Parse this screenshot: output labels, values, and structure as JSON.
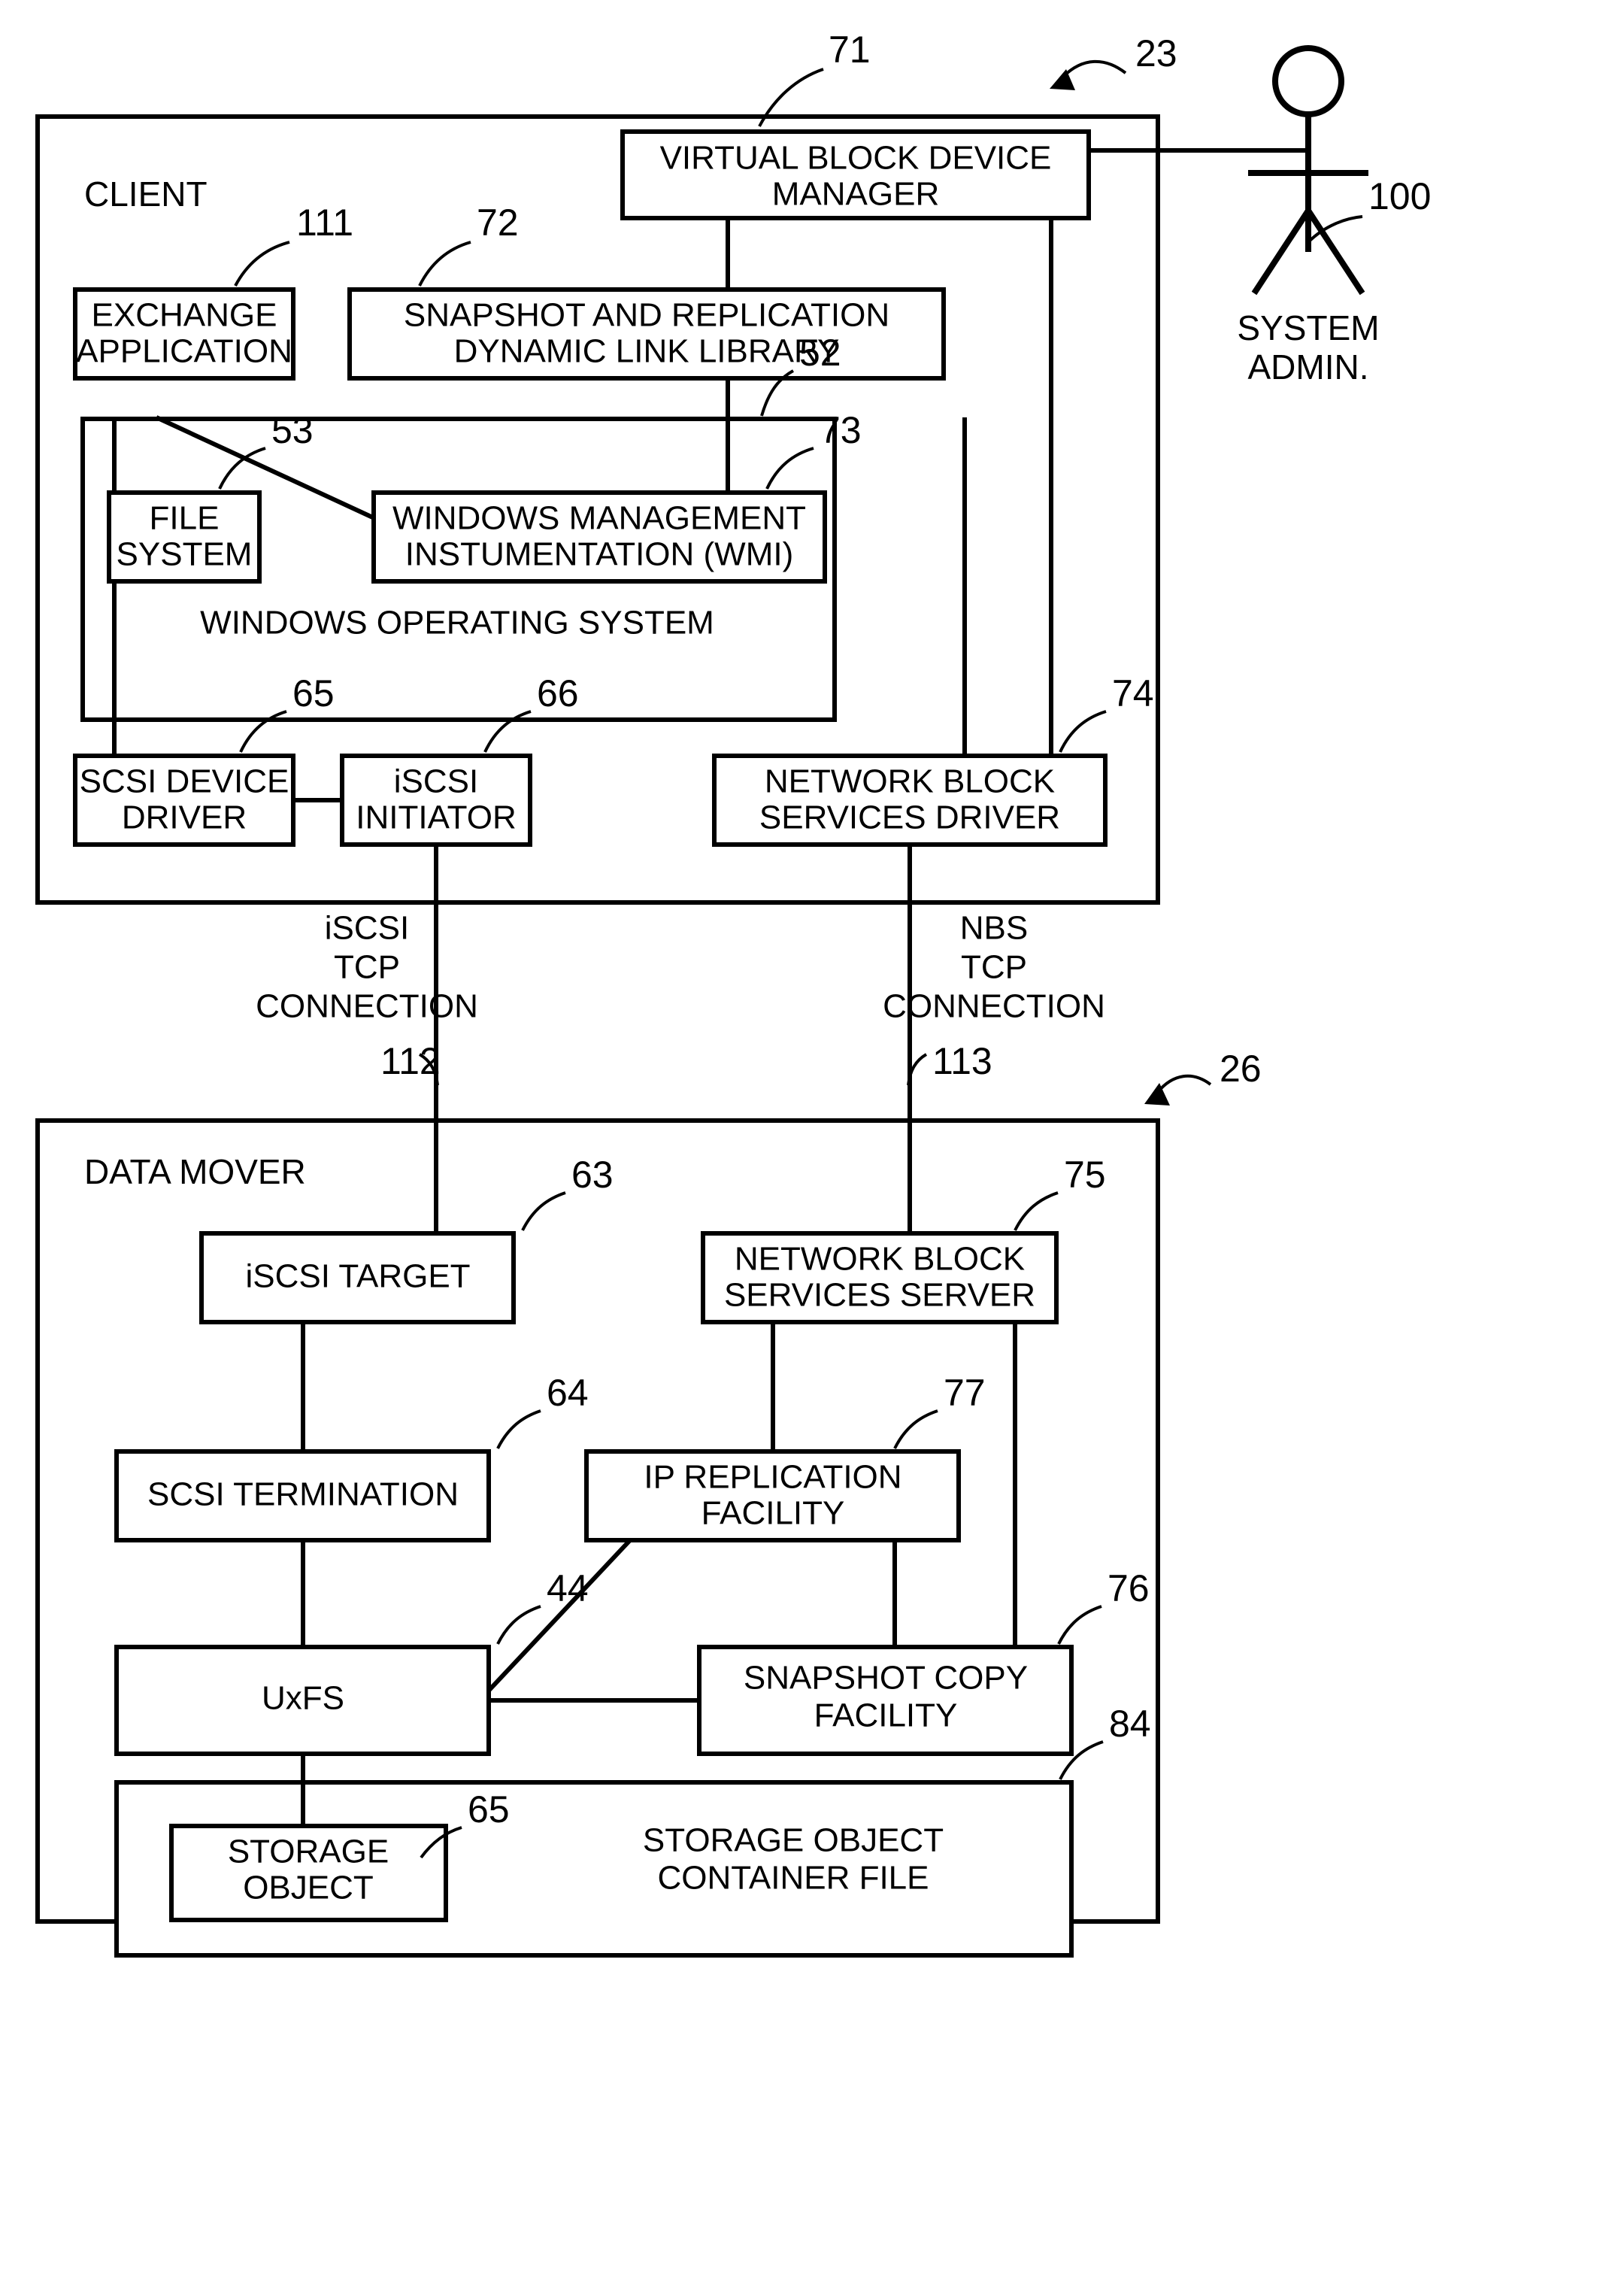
{
  "figure": {
    "domain": "patent-block-diagram",
    "background": "#ffffff",
    "line_color": "#000000"
  },
  "containers": [
    {
      "id": "client",
      "label": "CLIENT",
      "ref": "23"
    },
    {
      "id": "data_mover",
      "label": "DATA MOVER",
      "ref": "26"
    },
    {
      "id": "windows_os",
      "label": "WINDOWS OPERATING SYSTEM",
      "ref": "52"
    },
    {
      "id": "container_file",
      "label_line1": "STORAGE OBJECT",
      "label_line2": "CONTAINER FILE",
      "ref": "84"
    }
  ],
  "client_blocks": [
    {
      "id": "vbdm",
      "line1": "VIRTUAL BLOCK DEVICE",
      "line2": "MANAGER",
      "ref": "71"
    },
    {
      "id": "exchange_app",
      "line1": "EXCHANGE",
      "line2": "APPLICATION",
      "ref": "111"
    },
    {
      "id": "snap_dll",
      "line1": "SNAPSHOT AND REPLICATION",
      "line2": "DYNAMIC LINK LIBRARY",
      "ref": "72"
    },
    {
      "id": "file_system",
      "line1": "FILE",
      "line2": "SYSTEM",
      "ref": "53"
    },
    {
      "id": "wmi",
      "line1": "WINDOWS MANAGEMENT",
      "line2": "INSTUMENTATION (WMI)",
      "ref": "73"
    },
    {
      "id": "scsi_device_driver",
      "line1": "SCSI DEVICE",
      "line2": "DRIVER",
      "ref": "65"
    },
    {
      "id": "iscsi_initiator",
      "line1": "iSCSI",
      "line2": "INITIATOR",
      "ref": "66"
    },
    {
      "id": "nbs_driver",
      "line1": "NETWORK BLOCK",
      "line2": "SERVICES DRIVER",
      "ref": "74"
    }
  ],
  "data_mover_blocks": [
    {
      "id": "iscsi_target",
      "line1": "iSCSI TARGET",
      "line2": "",
      "ref": "63"
    },
    {
      "id": "nbs_server",
      "line1": "NETWORK BLOCK",
      "line2": "SERVICES SERVER",
      "ref": "75"
    },
    {
      "id": "scsi_termination",
      "line1": "SCSI TERMINATION",
      "line2": "",
      "ref": "64"
    },
    {
      "id": "ip_replication",
      "line1": "IP REPLICATION",
      "line2": "FACILITY",
      "ref": "77"
    },
    {
      "id": "uxfs",
      "line1": "UxFS",
      "line2": "",
      "ref": "44"
    },
    {
      "id": "snapshot_copy",
      "line1": "SNAPSHOT COPY",
      "line2": "FACILITY",
      "ref": "76"
    },
    {
      "id": "storage_object",
      "line1": "STORAGE",
      "line2": "OBJECT",
      "ref": "65"
    }
  ],
  "actor": {
    "id": "system_admin",
    "line1": "SYSTEM",
    "line2": "ADMIN.",
    "ref": "100"
  },
  "connection_labels": [
    {
      "id": "iscsi_tcp_connection",
      "line1": "iSCSI",
      "line2": "TCP",
      "line3": "CONNECTION",
      "ref": "112"
    },
    {
      "id": "nbs_tcp_connection",
      "line1": "NBS",
      "line2": "TCP",
      "line3": "CONNECTION",
      "ref": "113"
    }
  ],
  "reference_numerals": {
    "client_system": "23",
    "data_mover_system": "26",
    "vbdm": "71",
    "exchange_app": "111",
    "snap_dll": "72",
    "windows_os": "52",
    "file_system": "53",
    "wmi": "73",
    "scsi_device_driver": "65",
    "iscsi_initiator": "66",
    "nbs_driver": "74",
    "system_admin": "100",
    "iscsi_conn": "112",
    "nbs_conn": "113",
    "iscsi_target": "63",
    "nbs_server": "75",
    "scsi_termination": "64",
    "ip_replication": "77",
    "uxfs": "44",
    "snapshot_copy": "76",
    "storage_object": "65",
    "container_file": "84"
  }
}
